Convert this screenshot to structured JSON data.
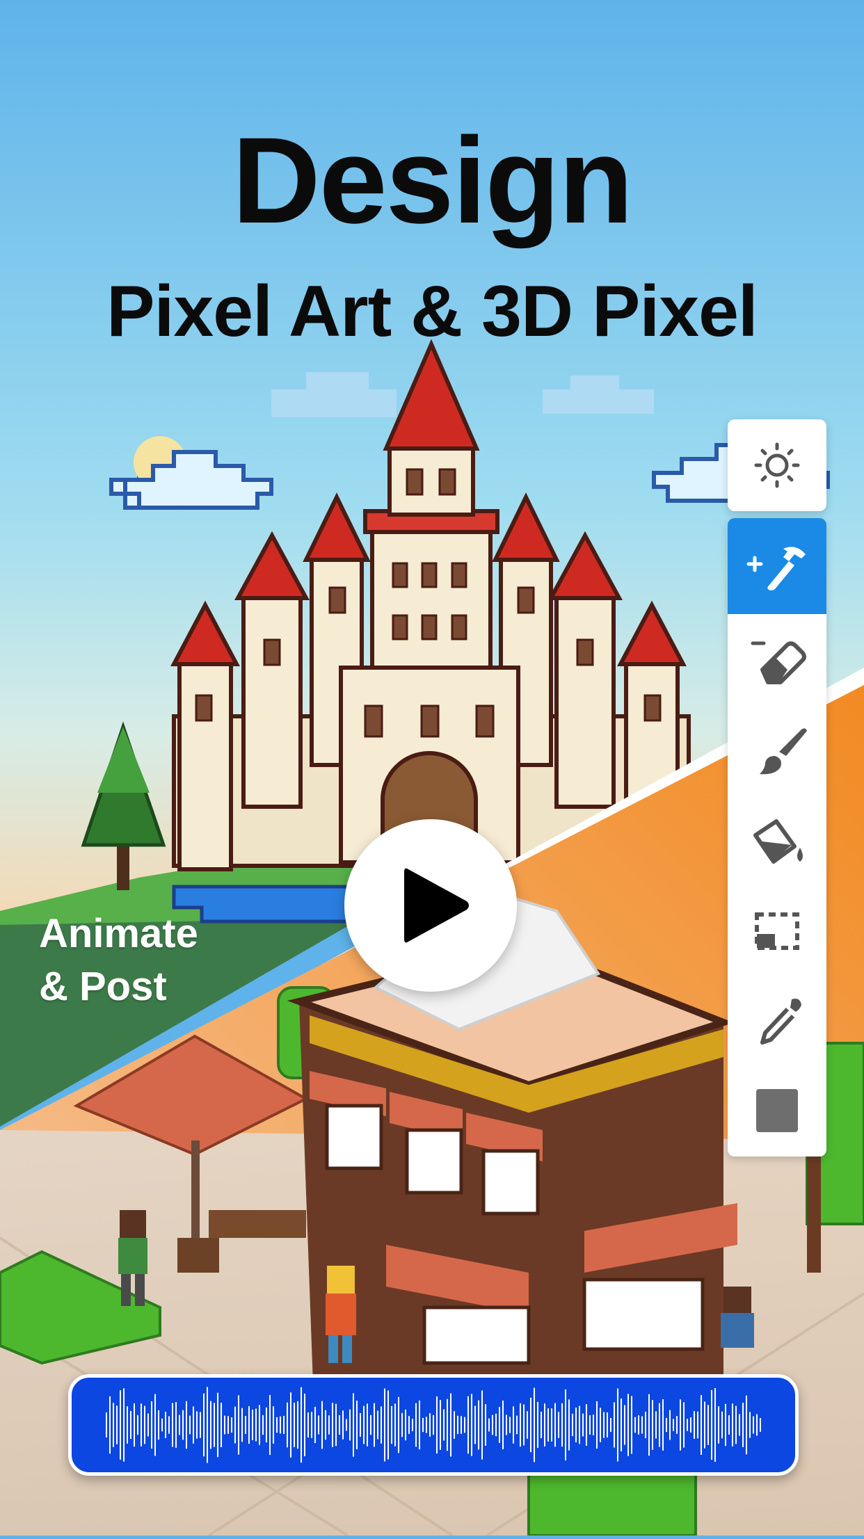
{
  "headline": {
    "title": "Design",
    "subtitle": "Pixel Art & 3D Pixel"
  },
  "caption": {
    "line1": "Animate",
    "line2": "& Post"
  },
  "toolbar": {
    "top_tool": {
      "icon": "sun-icon"
    },
    "tools": [
      {
        "icon": "add-hammer-icon",
        "active": true
      },
      {
        "icon": "eraser-icon",
        "active": false
      },
      {
        "icon": "brush-icon",
        "active": false
      },
      {
        "icon": "paint-bucket-icon",
        "active": false
      },
      {
        "icon": "selection-icon",
        "active": false
      },
      {
        "icon": "eyedropper-icon",
        "active": false
      },
      {
        "icon": "color-swatch-icon",
        "active": false
      }
    ],
    "active_color": "#1a8ae6",
    "swatch_color": "#6e6e6e"
  },
  "colors": {
    "sky_top": "#5fb3ea",
    "sky_bottom": "#f3dcb8",
    "orange_panel": "#f2932a",
    "audio_bar": "#0b47e0"
  }
}
